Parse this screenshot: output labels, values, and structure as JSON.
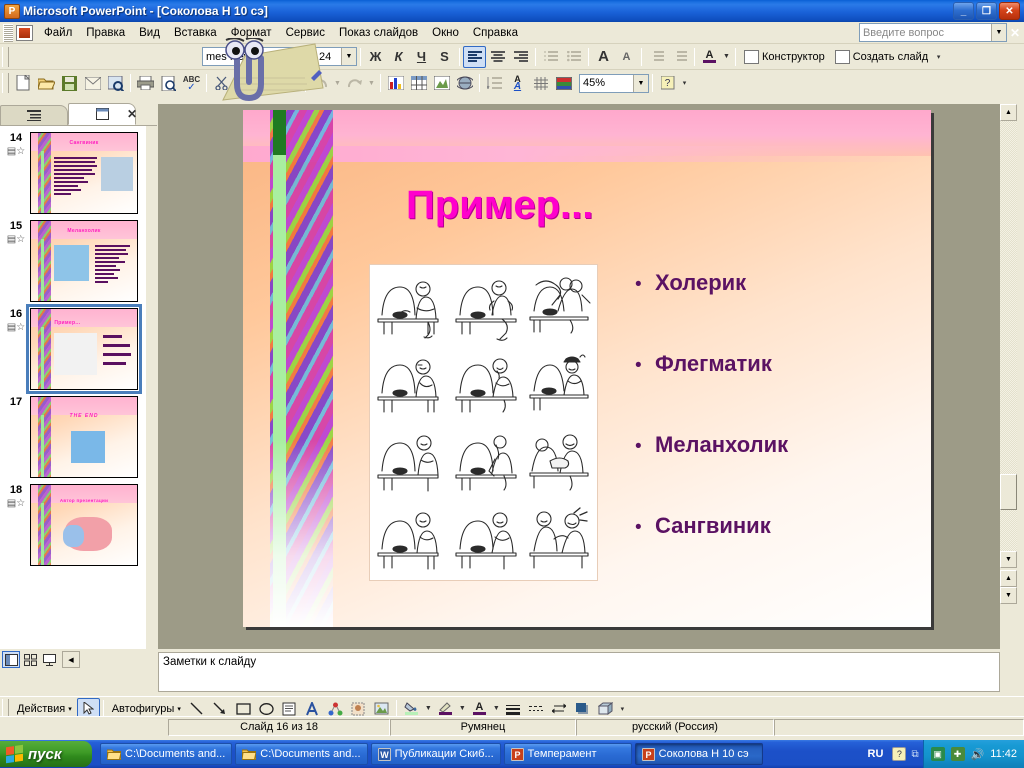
{
  "window": {
    "title": "Microsoft PowerPoint - [Соколова Н 10 сэ]",
    "app_icon": "powerpoint-icon",
    "minimize": "_",
    "restore": "❐",
    "close": "✕"
  },
  "menus": [
    {
      "label": "Файл",
      "mnemonic": "Ф"
    },
    {
      "label": "Правка",
      "mnemonic": "П"
    },
    {
      "label": "Вид",
      "mnemonic": "В"
    },
    {
      "label": "Вставка",
      "mnemonic": "а"
    },
    {
      "label": "Формат",
      "mnemonic": "м"
    },
    {
      "label": "Сервис",
      "mnemonic": "С"
    },
    {
      "label": "Показ слайдов",
      "mnemonic": "к"
    },
    {
      "label": "Окно",
      "mnemonic": "О"
    },
    {
      "label": "Справка",
      "mnemonic": "С"
    }
  ],
  "ask_box": {
    "placeholder": "Введите вопрос",
    "dropdown_icon": "chevron-down-icon",
    "close_icon": "close-icon"
  },
  "formatting_toolbar": {
    "font_name": "mes New Roman",
    "font_size": "24",
    "bold": "Ж",
    "italic": "К",
    "underline": "Ч",
    "shadow": "S",
    "align_left": "align-left-icon",
    "align_center": "align-center-icon",
    "align_right": "align-right-icon",
    "numbering": "numbered-list-icon",
    "bullets": "bulleted-list-icon",
    "grow_font": "A",
    "shrink_font": "A",
    "decrease_indent": "decrease-indent-icon",
    "increase_indent": "increase-indent-icon",
    "font_color": "A",
    "design_label": "Конструктор",
    "new_slide_label": "Создать слайд",
    "overflow": "▾"
  },
  "standard_toolbar": {
    "new": "new-document-icon",
    "open": "open-folder-icon",
    "save": "save-disk-icon",
    "mail": "email-icon",
    "search": "search-icon",
    "print": "printer-icon",
    "preview": "print-preview-icon",
    "spelling": "spell-check-icon",
    "cut": "scissors-icon",
    "copy": "copy-icon",
    "paste": "paste-icon",
    "format_painter": "format-painter-icon",
    "undo": "undo-icon",
    "redo": "redo-icon",
    "chart": "insert-chart-icon",
    "table": "insert-table-icon",
    "insert_object": "insert-object-icon",
    "hyperlink": "hyperlink-icon",
    "expand_all": "expand-all-icon",
    "show_formatting": "show-formatting-icon",
    "grid": "grid-icon",
    "color_grayscale": "color-grayscale-icon",
    "zoom_value": "45%",
    "help": "help-icon",
    "overflow": "▾"
  },
  "assistant": {
    "name": "office-assistant-clippy"
  },
  "left_pane": {
    "tab_outline": "outline-tab-icon",
    "tab_slides": "slides-tab-icon",
    "close": "✕",
    "slides": [
      {
        "number": "14",
        "animation": "animation-icon",
        "title": "Сангвиник",
        "layout": "text-left-picture-right"
      },
      {
        "number": "15",
        "animation": "animation-icon",
        "title": "Меланхолик",
        "layout": "picture-left-text-right"
      },
      {
        "number": "16",
        "animation": "animation-icon",
        "title": "Пример...",
        "layout": "picture-left-bullets-right",
        "selected": true
      },
      {
        "number": "17",
        "animation": "",
        "title": "THE END",
        "layout": "picture-center"
      },
      {
        "number": "18",
        "animation": "animation-icon",
        "title": "Автор презентации",
        "layout": "picture-center"
      }
    ]
  },
  "view_buttons": {
    "normal": "normal-view-icon",
    "slide_sorter": "slide-sorter-icon",
    "slide_show": "slide-show-icon",
    "scroll_left": "◀"
  },
  "slide": {
    "title": "Пример...",
    "picture_alt": "bidstrup-temperaments-cartoon",
    "bullet_char": "•",
    "bullets": [
      "Холерик",
      "Флегматик",
      "Меланхолик",
      "Сангвиник"
    ],
    "colors": {
      "title": "#ff00cc",
      "bullets": "#5b1263",
      "background_top": "#ffa8cc",
      "background_body": "#ffc89b"
    }
  },
  "scrollbar": {
    "up": "▲",
    "down": "▼",
    "prev_slide": "▲",
    "next_slide": "▼"
  },
  "notes": {
    "placeholder": "Заметки к слайду"
  },
  "drawing_toolbar": {
    "actions": "Действия",
    "actions_arrow": "▾",
    "select": "select-arrow-icon",
    "autoshapes": "Автофигуры",
    "autoshapes_arrow": "▾",
    "line": "line-icon",
    "arrow": "arrow-icon",
    "rectangle": "rectangle-icon",
    "oval": "oval-icon",
    "textbox": "text-box-icon",
    "wordart": "wordart-icon",
    "diagram": "diagram-icon",
    "clipart": "clip-art-icon",
    "picture": "insert-picture-icon",
    "fill_color": "fill-color-icon",
    "line_color": "line-color-icon",
    "font_color": "font-color-icon",
    "line_style": "line-style-icon",
    "dash_style": "dash-style-icon",
    "arrow_style": "arrow-style-icon",
    "shadow_style": "shadow-style-icon",
    "3d_style": "3d-style-icon",
    "overflow": "▾"
  },
  "status_bar": {
    "slide_counter": "Слайд 16 из 18",
    "design_template": "Румянец",
    "language": "русский (Россия)"
  },
  "taskbar": {
    "start": "пуск",
    "start_icon": "windows-flag-icon",
    "items": [
      {
        "label": "C:\\Documents and...",
        "icon": "folder-icon",
        "active": false
      },
      {
        "label": "C:\\Documents and...",
        "icon": "folder-icon",
        "active": false
      },
      {
        "label": "Публикации Скиб...",
        "icon": "word-icon",
        "active": false
      },
      {
        "label": "Темперамент",
        "icon": "powerpoint-icon",
        "active": false
      },
      {
        "label": "Соколова Н 10 сэ",
        "icon": "powerpoint-icon",
        "active": true
      }
    ],
    "language_indicator": "RU",
    "tray_icons": [
      "help-icon",
      "show-desktop-icon",
      "media-icon",
      "network-icon",
      "volume-icon"
    ],
    "clock": "11:42"
  }
}
